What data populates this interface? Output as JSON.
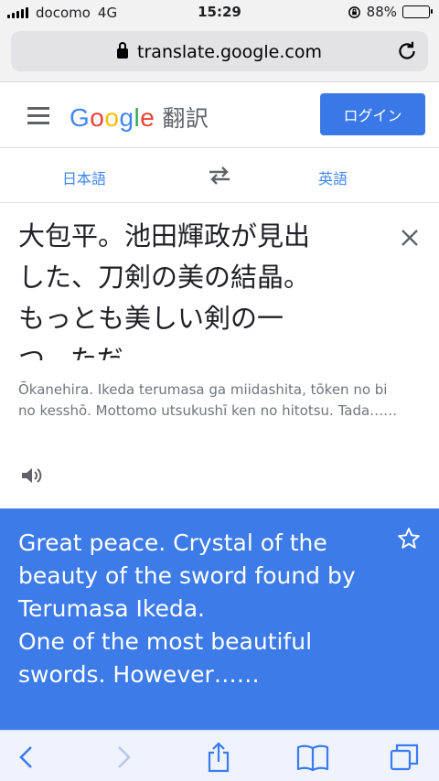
{
  "status_bar": {
    "carrier": "docomo",
    "network": "4G",
    "time": "15:29",
    "battery_percent": "88%",
    "battery_level": 0.88
  },
  "browser": {
    "url": "translate.google.com"
  },
  "header": {
    "logo": [
      "G",
      "o",
      "o",
      "g",
      "l",
      "e"
    ],
    "logo_colors": [
      "#4285f4",
      "#ea4335",
      "#fbbc05",
      "#4285f4",
      "#34a853",
      "#ea4335"
    ],
    "logo_suffix": "翻訳",
    "login_label": "ログイン"
  },
  "languages": {
    "source": "日本語",
    "target": "英語"
  },
  "source": {
    "lines": [
      "大包平。池田輝政が見出",
      "した、刀剣の美の結晶。",
      "もっとも美しい剣の一",
      "つ。ただ……"
    ],
    "romanization": "Ōkanehira. Ikeda terumasa ga miidashita, tōken no bi no kesshō. Mottomo utsukushī ken no hitotsu. Tada……"
  },
  "result": {
    "lines": [
      "Great peace. Crystal of the",
      "beauty of the sword found by",
      "Terumasa Ikeda.",
      "One of the most beautiful",
      "swords. However……"
    ]
  },
  "colors": {
    "accent": "#3b78e7",
    "result_bg": "#3d7be8",
    "lang_link": "#4285f4"
  }
}
